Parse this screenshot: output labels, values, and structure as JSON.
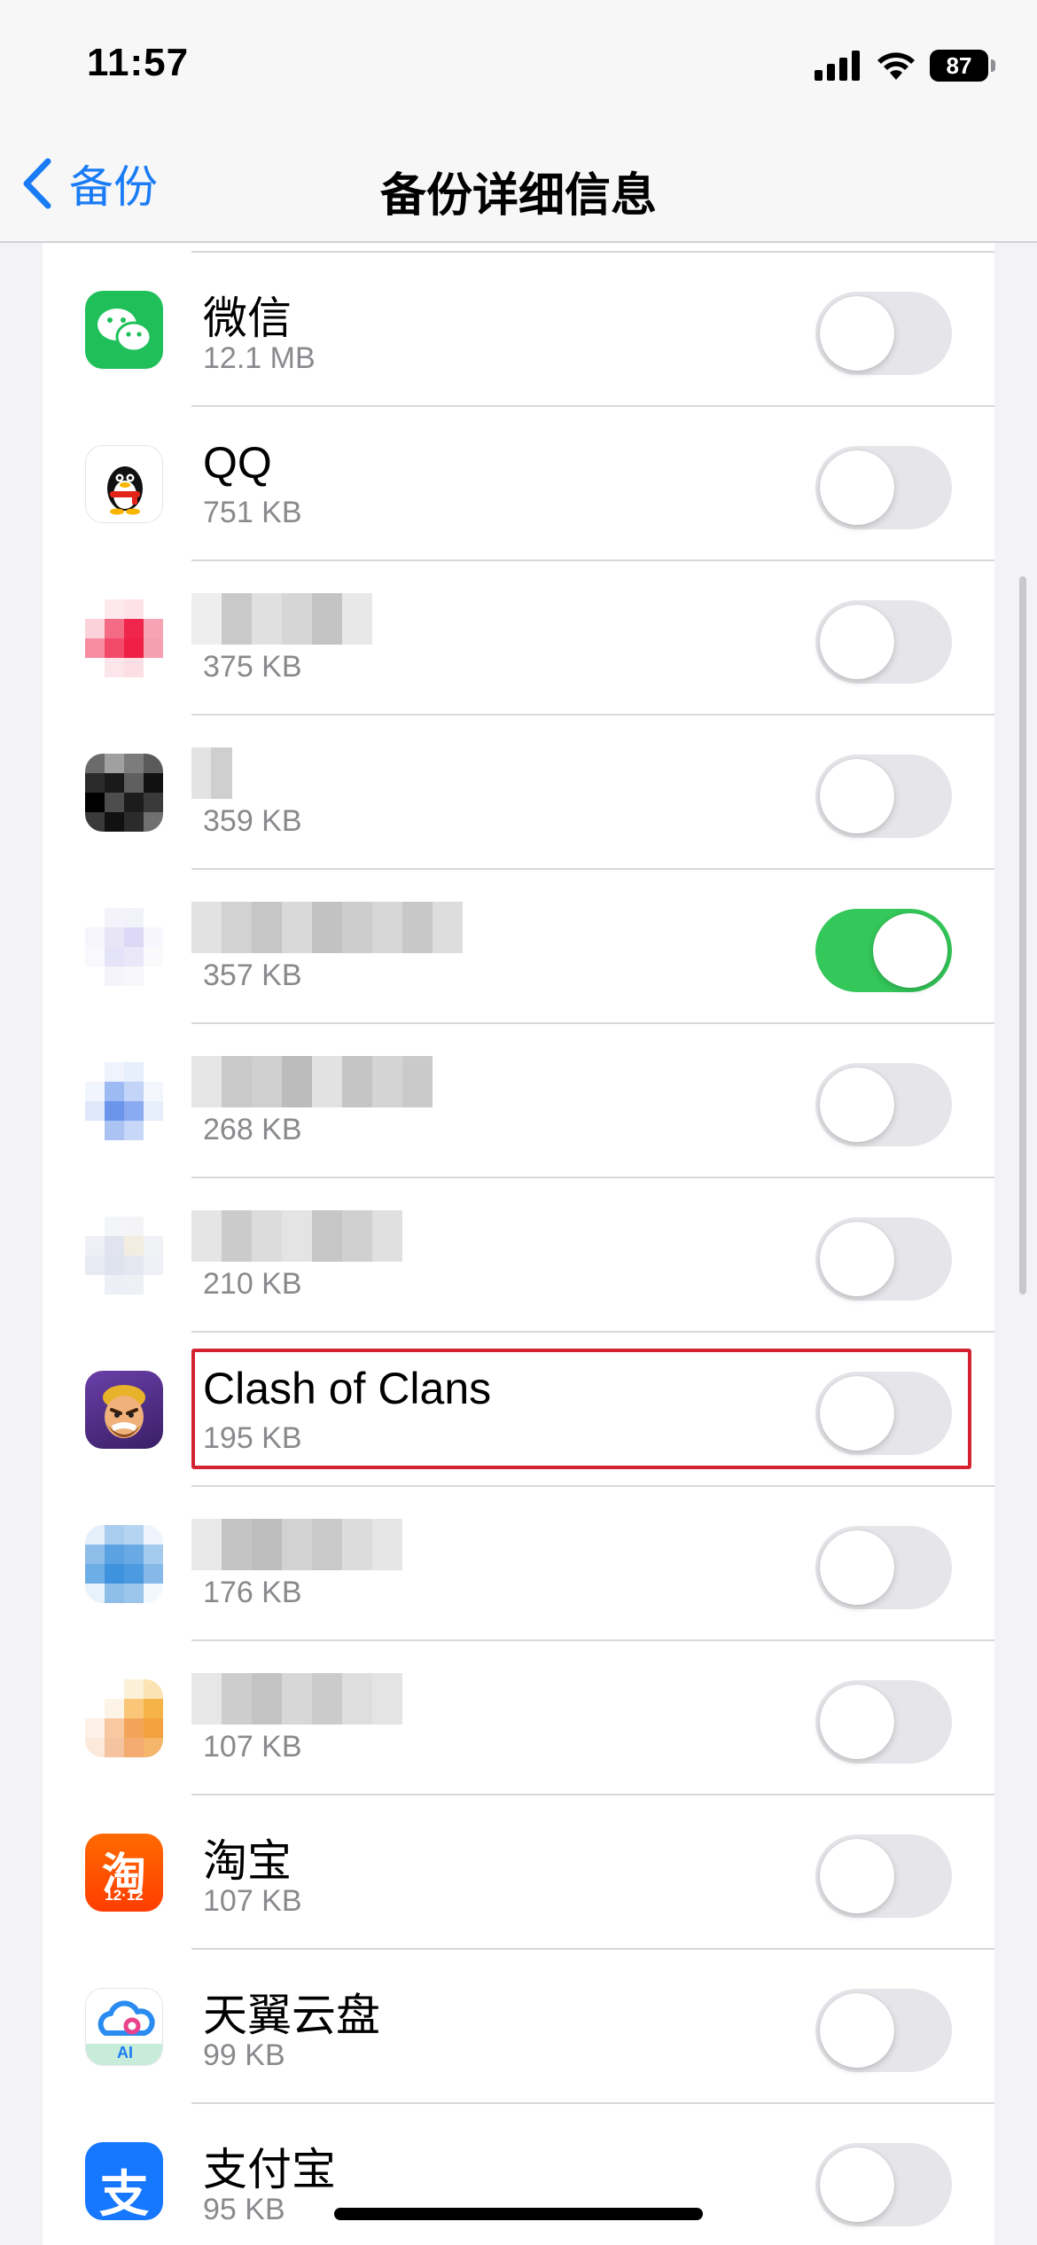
{
  "status_bar": {
    "time": "11:57",
    "battery": "87"
  },
  "nav": {
    "back_label": "备份",
    "title": "备份详细信息"
  },
  "apps": [
    {
      "name": "微信",
      "size": "12.1 MB",
      "enabled": false,
      "icon": "wechat-icon"
    },
    {
      "name": "QQ",
      "size": "751 KB",
      "enabled": false,
      "icon": "qq-icon"
    },
    {
      "name": "",
      "size": "375 KB",
      "enabled": false,
      "icon": "blurred-app-icon"
    },
    {
      "name": "",
      "size": "359 KB",
      "enabled": false,
      "icon": "blurred-app-icon"
    },
    {
      "name": "",
      "size": "357 KB",
      "enabled": true,
      "icon": "blurred-app-icon"
    },
    {
      "name": "",
      "size": "268 KB",
      "enabled": false,
      "icon": "blurred-app-icon"
    },
    {
      "name": "",
      "size": "210 KB",
      "enabled": false,
      "icon": "blurred-app-icon"
    },
    {
      "name": "Clash of Clans",
      "size": "195 KB",
      "enabled": false,
      "icon": "clash-of-clans-icon",
      "highlighted": true
    },
    {
      "name": "",
      "size": "176 KB",
      "enabled": false,
      "icon": "blurred-app-icon"
    },
    {
      "name": "",
      "size": "107 KB",
      "enabled": false,
      "icon": "blurred-app-icon"
    },
    {
      "name": "淘宝",
      "size": "107 KB",
      "enabled": false,
      "icon": "taobao-icon"
    },
    {
      "name": "天翼云盘",
      "size": "99 KB",
      "enabled": false,
      "icon": "tianyi-cloud-icon"
    },
    {
      "name": "支付宝",
      "size": "95 KB",
      "enabled": false,
      "icon": "alipay-icon"
    }
  ],
  "icon_text": {
    "taobao": "淘",
    "taobao_badge": "12·12",
    "alipay": "支",
    "tianyi": "AI"
  },
  "colors": {
    "accent": "#1a7cf5",
    "toggle_on": "#34c759",
    "highlight": "#d42230"
  }
}
